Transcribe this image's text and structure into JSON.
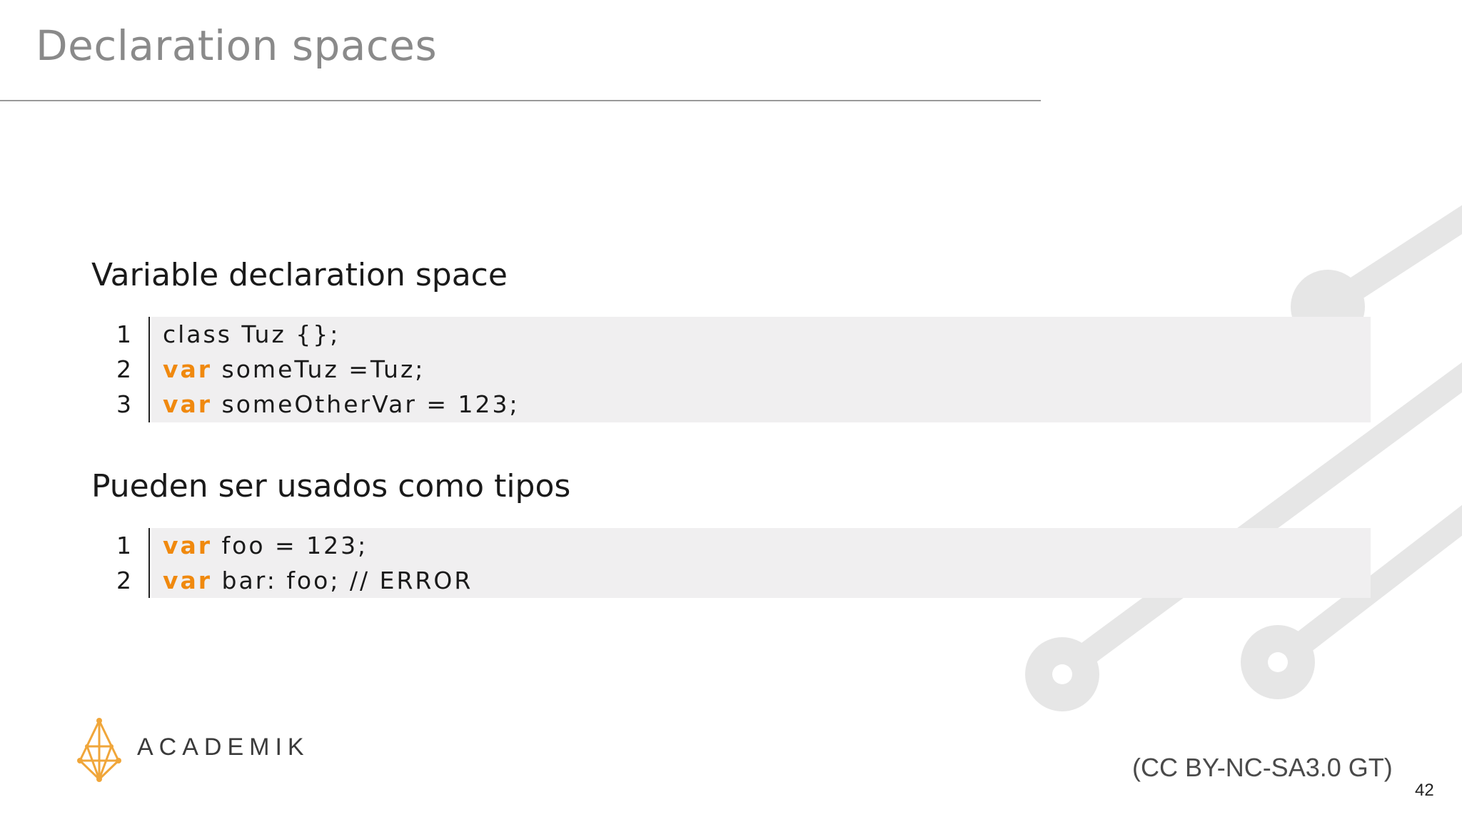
{
  "slide": {
    "title": "Declaration spaces",
    "page_number": "42",
    "license": "(CC BY-NC-SA3.0 GT)",
    "logo_text": "ACADEMIK",
    "accent_color": "#f0890e"
  },
  "section1": {
    "heading": "Variable declaration space",
    "lines": [
      {
        "num": "1",
        "keyword": "",
        "text": "class Tuz {};"
      },
      {
        "num": "2",
        "keyword": "var",
        "text": " someTuz =Tuz;"
      },
      {
        "num": "3",
        "keyword": "var",
        "text": " someOtherVar = 123;"
      }
    ]
  },
  "section2": {
    "heading": "Pueden ser usados como tipos",
    "lines": [
      {
        "num": "1",
        "keyword": "var",
        "text": " foo = 123;"
      },
      {
        "num": "2",
        "keyword": "var",
        "text": " bar: foo; // ERROR"
      }
    ]
  }
}
